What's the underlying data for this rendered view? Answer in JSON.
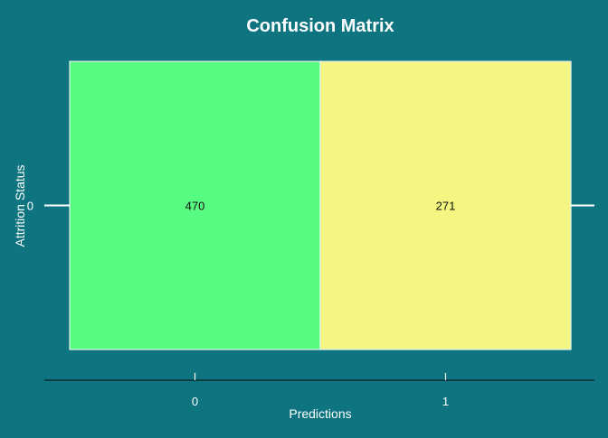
{
  "chart_data": {
    "type": "heatmap",
    "title": "Confusion Matrix",
    "xlabel": "Predictions",
    "ylabel": "Attrition Status",
    "x_categories": [
      "0",
      "1"
    ],
    "y_categories": [
      "0"
    ],
    "cells": [
      {
        "x": "0",
        "y": "0",
        "value": 470,
        "label": "470",
        "color": "#58fb82"
      },
      {
        "x": "1",
        "y": "0",
        "value": 271,
        "label": "271",
        "color": "#f3f781"
      }
    ],
    "grid": false,
    "legend": "none"
  },
  "colors": {
    "background": "#0e7580",
    "cell_border": "#e8f2ee",
    "axis_line": "#ffffff",
    "bottom_axis_line": "#0b1f24",
    "text_light": "#ffffff",
    "text_dark": "#111111"
  }
}
